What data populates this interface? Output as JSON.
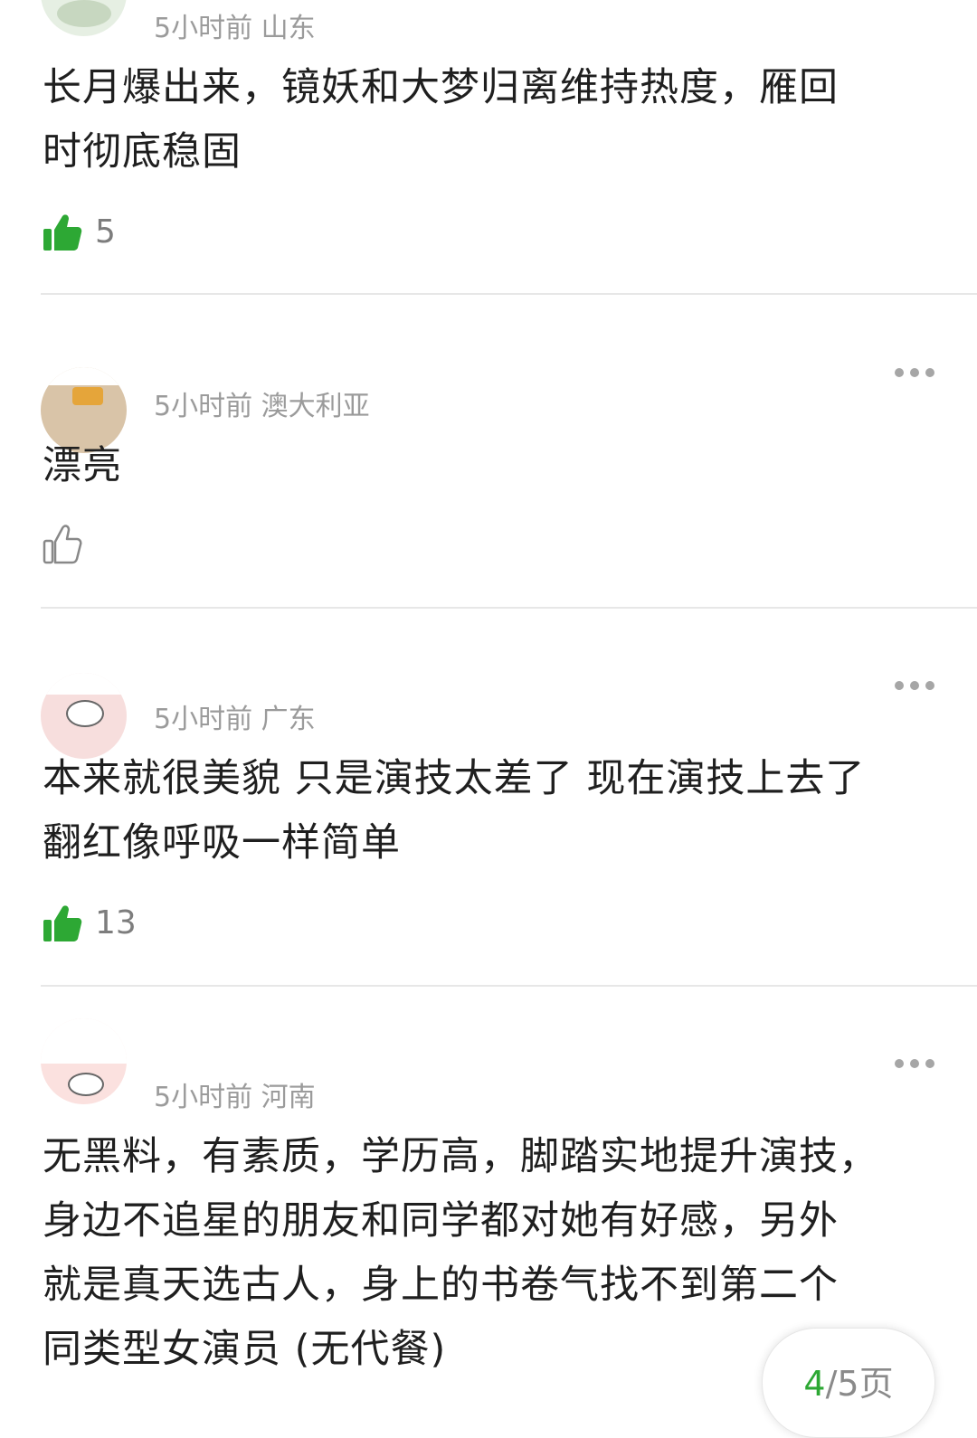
{
  "comments": [
    {
      "time": "5小时前",
      "location": "山东",
      "text_lines": [
        "长月爆出来，镜妖和大梦归离维持热度，雁回",
        "时彻底稳固"
      ],
      "likes": "5",
      "liked": true
    },
    {
      "time": "5小时前",
      "location": "澳大利亚",
      "text_lines": [
        "漂亮"
      ],
      "likes": "",
      "liked": false
    },
    {
      "time": "5小时前",
      "location": "广东",
      "text_lines": [
        "本来就很美貌 只是演技太差了 现在演技上去了",
        "翻红像呼吸一样简单"
      ],
      "likes": "13",
      "liked": true
    },
    {
      "time": "5小时前",
      "location": "河南",
      "text_lines": [
        "无黑料，有素质，学历高，脚踏实地提升演技，",
        "身边不追星的朋友和同学都对她有好感，另外",
        "就是真天选古人，身上的书卷气找不到第二个",
        "同类型女演员 (无代餐)"
      ],
      "likes": "",
      "liked": false
    }
  ],
  "pager": {
    "current": "4",
    "separator": "/",
    "total": "5",
    "unit": "页"
  },
  "icons": {
    "like_filled": "thumbs-up-filled-icon",
    "like_outline": "thumbs-up-outline-icon",
    "more": "more-dots-icon"
  },
  "colors": {
    "like_green": "#2da834",
    "meta_gray": "#9b9b9b",
    "text": "#1f1f1f",
    "divider": "#e7e7e7"
  }
}
